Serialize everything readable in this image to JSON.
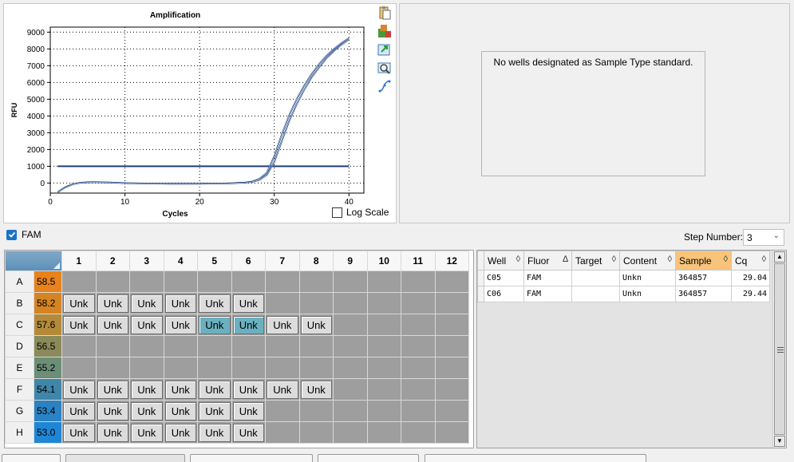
{
  "chart": {
    "log_scale_label": "Log Scale",
    "log_scale_checked": false,
    "tools": [
      "clipboard-icon",
      "plate-icon",
      "export-icon",
      "zoom-icon",
      "curve-icon"
    ]
  },
  "chart_data": {
    "type": "line",
    "title": "Amplification",
    "xlabel": "Cycles",
    "ylabel": "RFU",
    "xlim": [
      0,
      42
    ],
    "ylim": [
      -600,
      9300
    ],
    "xticks": [
      0,
      10,
      20,
      30,
      40
    ],
    "yticks": [
      0,
      1000,
      2000,
      3000,
      4000,
      5000,
      6000,
      7000,
      8000,
      9000
    ],
    "grid": true,
    "threshold": 1000,
    "threshold_color": "#1d3f7a",
    "series": [
      {
        "well": "C05",
        "x": [
          1,
          2,
          3,
          4,
          5,
          6,
          8,
          10,
          12,
          14,
          16,
          18,
          20,
          22,
          24,
          25,
          26,
          27,
          28,
          29,
          30,
          31,
          32,
          33,
          34,
          35,
          36,
          37,
          38,
          39,
          40
        ],
        "y": [
          -540,
          -250,
          -60,
          20,
          50,
          55,
          40,
          0,
          -20,
          -30,
          -40,
          -40,
          -40,
          -30,
          -10,
          10,
          30,
          80,
          250,
          620,
          1600,
          2900,
          4050,
          5000,
          5800,
          6500,
          7100,
          7600,
          8000,
          8350,
          8650
        ]
      },
      {
        "well": "C06",
        "x": [
          1,
          2,
          3,
          4,
          5,
          6,
          8,
          10,
          12,
          14,
          16,
          18,
          20,
          22,
          24,
          25,
          26,
          27,
          28,
          29,
          30,
          31,
          32,
          33,
          34,
          35,
          36,
          37,
          38,
          39,
          40
        ],
        "y": [
          -540,
          -260,
          -70,
          10,
          40,
          45,
          30,
          -10,
          -25,
          -35,
          -45,
          -45,
          -45,
          -35,
          -20,
          0,
          20,
          60,
          180,
          480,
          1250,
          2500,
          3700,
          4700,
          5550,
          6300,
          6900,
          7450,
          7880,
          8250,
          8570
        ]
      }
    ]
  },
  "std_panel": {
    "message": "No wells designated as Sample Type standard."
  },
  "fluor": {
    "label": "FAM",
    "checked": true
  },
  "step": {
    "label": "Step Number:",
    "value": "3"
  },
  "plate": {
    "columns": [
      "1",
      "2",
      "3",
      "4",
      "5",
      "6",
      "7",
      "8",
      "9",
      "10",
      "11",
      "12"
    ],
    "rows": [
      {
        "label": "A",
        "temp": "58.5",
        "temp_color": "#e8821a",
        "wells": [
          "",
          "",
          "",
          "",
          "",
          "",
          "",
          "",
          "",
          "",
          "",
          ""
        ]
      },
      {
        "label": "B",
        "temp": "58.2",
        "temp_color": "#d48422",
        "wells": [
          "Unk",
          "Unk",
          "Unk",
          "Unk",
          "Unk",
          "Unk",
          "",
          "",
          "",
          "",
          "",
          ""
        ]
      },
      {
        "label": "C",
        "temp": "57.6",
        "temp_color": "#b48a3a",
        "wells": [
          "Unk",
          "Unk",
          "Unk",
          "Unk",
          "Unk",
          "Unk",
          "Unk",
          "Unk",
          "",
          "",
          "",
          ""
        ],
        "selected": [
          4,
          5
        ]
      },
      {
        "label": "D",
        "temp": "56.5",
        "temp_color": "#8a8a5a",
        "wells": [
          "",
          "",
          "",
          "",
          "",
          "",
          "",
          "",
          "",
          "",
          "",
          ""
        ]
      },
      {
        "label": "E",
        "temp": "55.2",
        "temp_color": "#6c8e76",
        "wells": [
          "",
          "",
          "",
          "",
          "",
          "",
          "",
          "",
          "",
          "",
          "",
          ""
        ]
      },
      {
        "label": "F",
        "temp": "54.1",
        "temp_color": "#3f86a8",
        "wells": [
          "Unk",
          "Unk",
          "Unk",
          "Unk",
          "Unk",
          "Unk",
          "Unk",
          "Unk",
          "",
          "",
          "",
          ""
        ]
      },
      {
        "label": "G",
        "temp": "53.4",
        "temp_color": "#2a82c4",
        "wells": [
          "Unk",
          "Unk",
          "Unk",
          "Unk",
          "Unk",
          "Unk",
          "",
          "",
          "",
          "",
          "",
          ""
        ]
      },
      {
        "label": "H",
        "temp": "53.0",
        "temp_color": "#1f86d6",
        "wells": [
          "Unk",
          "Unk",
          "Unk",
          "Unk",
          "Unk",
          "Unk",
          "",
          "",
          "",
          "",
          "",
          ""
        ]
      }
    ]
  },
  "results": {
    "headers": [
      {
        "label": "Well",
        "ind": "◊"
      },
      {
        "label": "Fluor",
        "ind": "∆"
      },
      {
        "label": "Target",
        "ind": "◊"
      },
      {
        "label": "Content",
        "ind": "◊"
      },
      {
        "label": "Sample",
        "ind": "◊",
        "sorted": true
      },
      {
        "label": "Cq",
        "ind": "◊"
      }
    ],
    "rows": [
      [
        "C05",
        "FAM",
        "",
        "Unkn",
        "364857",
        "29.04"
      ],
      [
        "C06",
        "FAM",
        "",
        "Unkn",
        "364857",
        "29.44"
      ]
    ]
  }
}
